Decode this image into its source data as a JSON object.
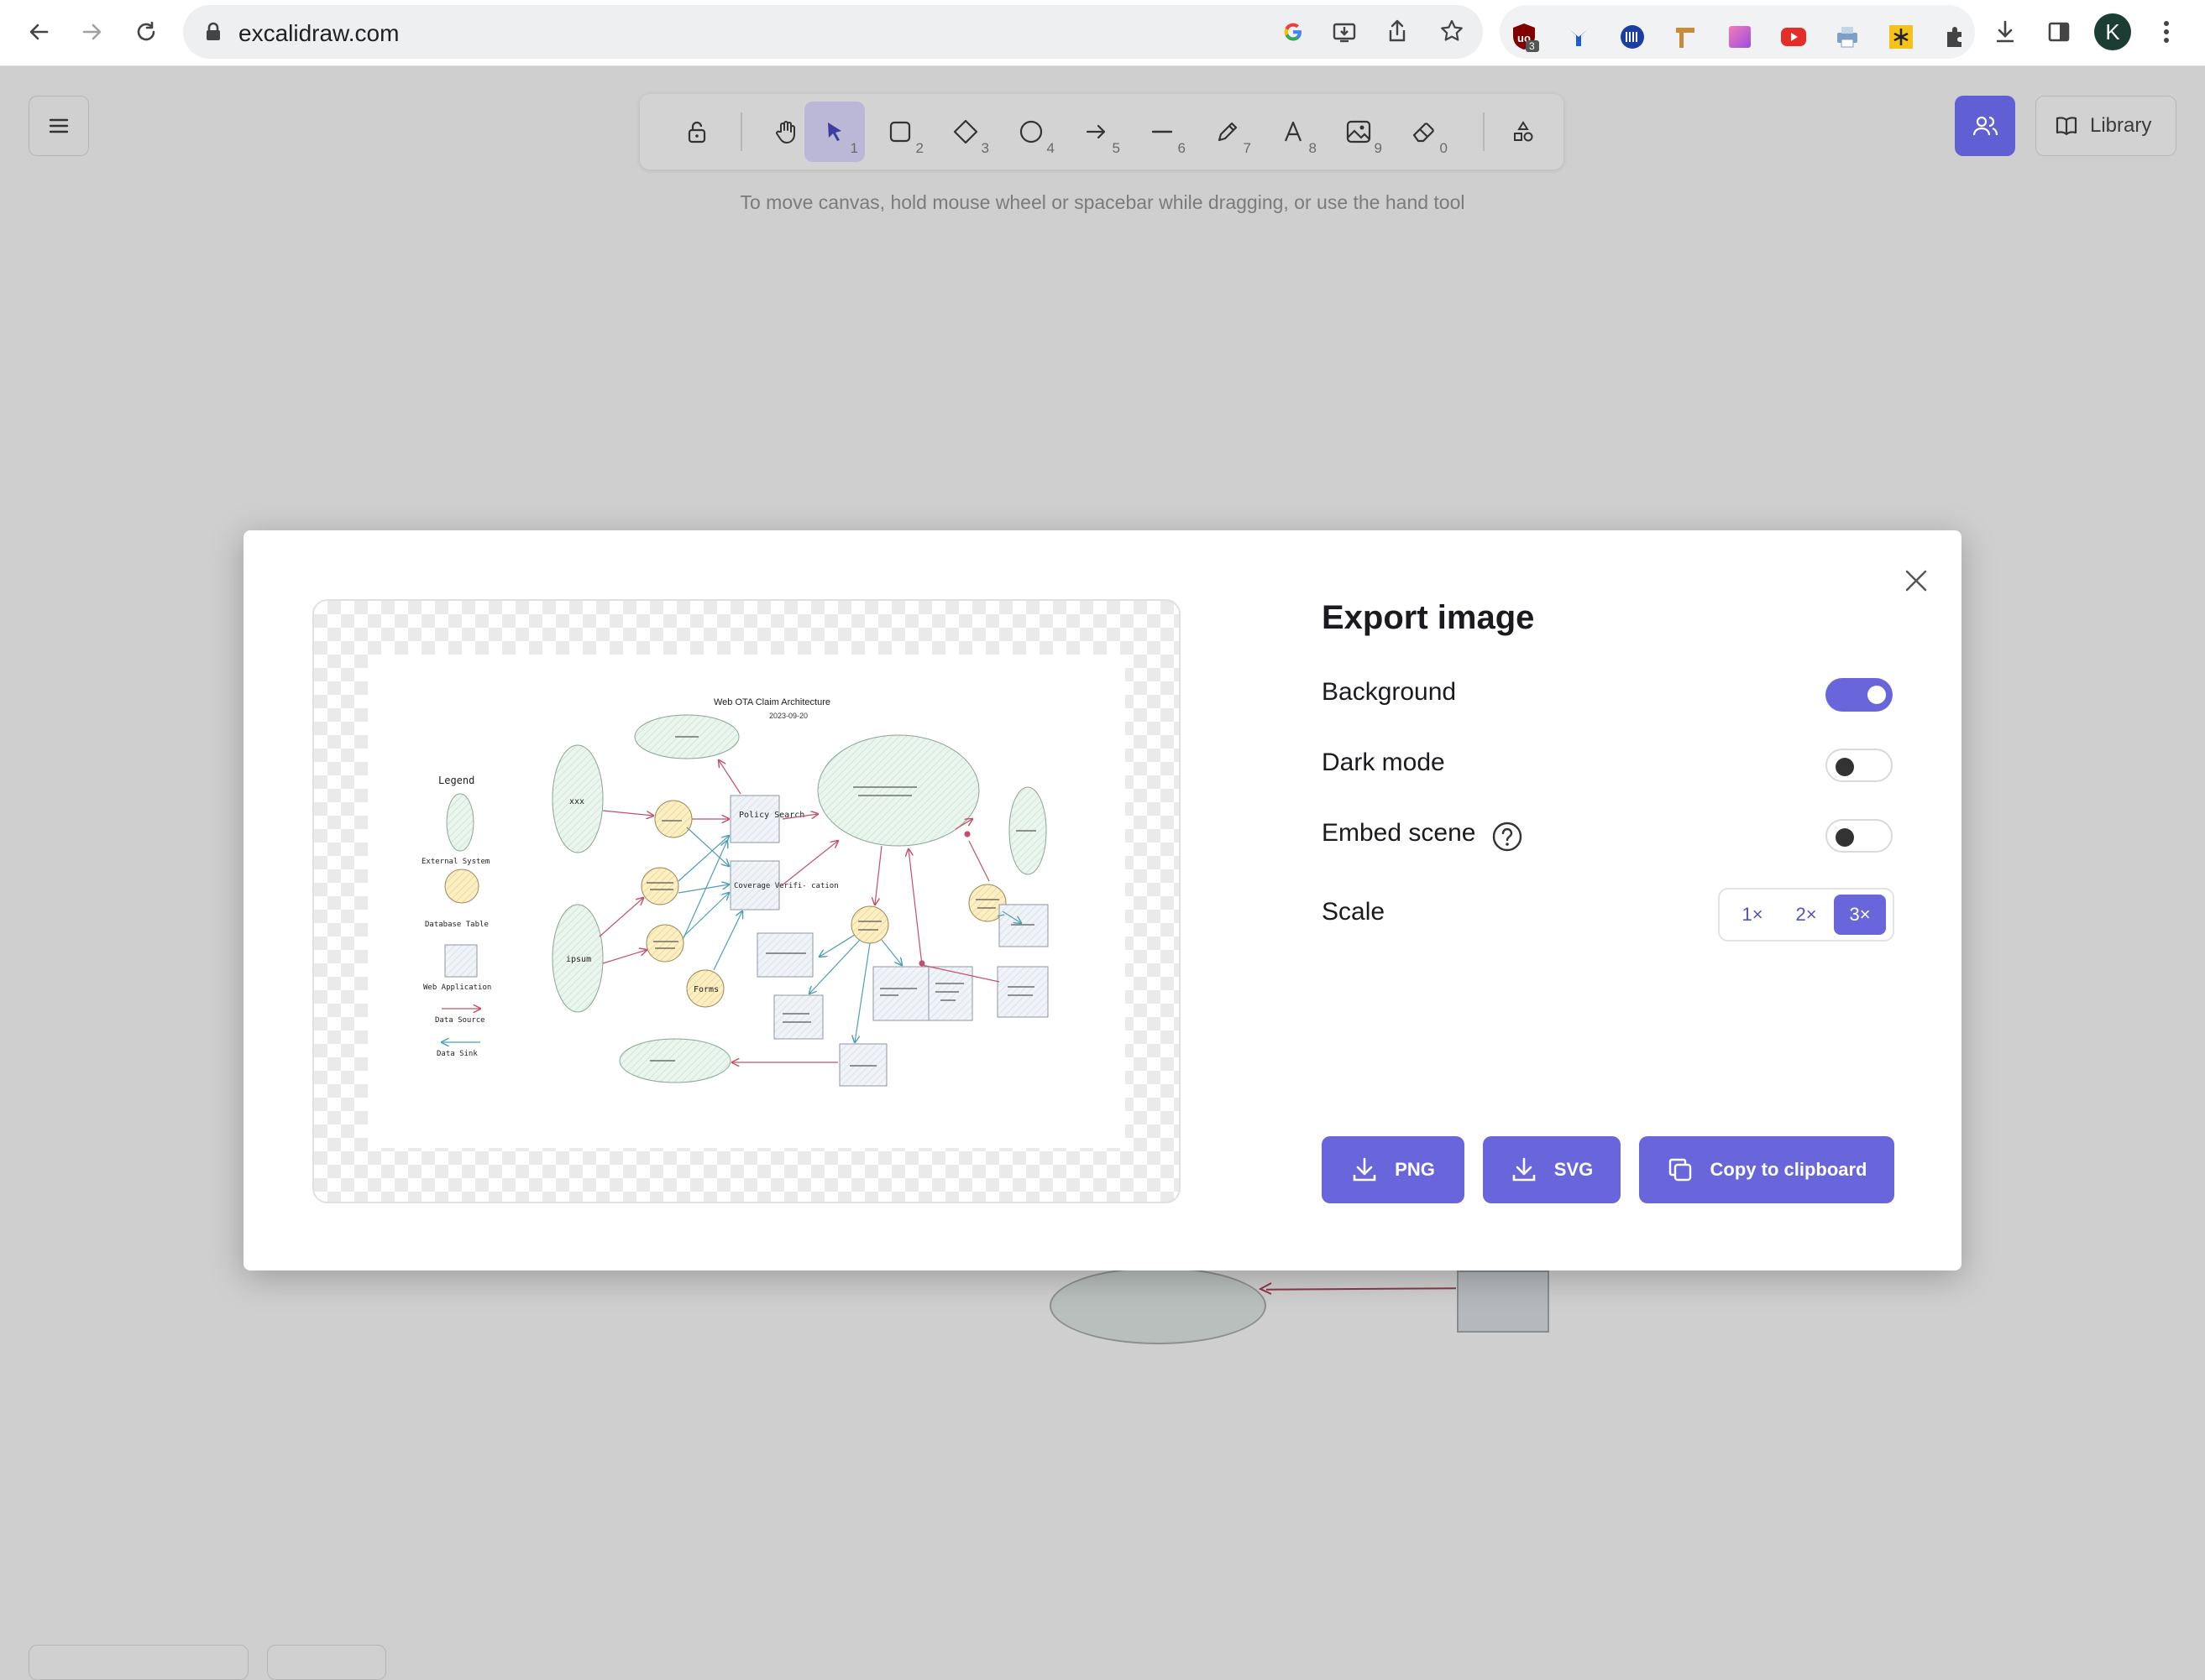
{
  "browser": {
    "url": "excalidraw.com",
    "extension_badge": "3",
    "profile_initial": "K"
  },
  "app": {
    "hint": "To move canvas, hold mouse wheel or spacebar while dragging, or use the hand tool",
    "library_label": "Library",
    "toolbar": {
      "tools": [
        {
          "name": "lock",
          "num": ""
        },
        {
          "name": "hand",
          "num": ""
        },
        {
          "name": "selection",
          "num": "1"
        },
        {
          "name": "rectangle",
          "num": "2"
        },
        {
          "name": "diamond",
          "num": "3"
        },
        {
          "name": "ellipse",
          "num": "4"
        },
        {
          "name": "arrow",
          "num": "5"
        },
        {
          "name": "line",
          "num": "6"
        },
        {
          "name": "draw",
          "num": "7"
        },
        {
          "name": "text",
          "num": "8"
        },
        {
          "name": "image",
          "num": "9"
        },
        {
          "name": "eraser",
          "num": "0"
        },
        {
          "name": "more-shapes",
          "num": ""
        }
      ]
    }
  },
  "dialog": {
    "title": "Export image",
    "options": {
      "background": {
        "label": "Background",
        "on": true
      },
      "dark_mode": {
        "label": "Dark mode",
        "on": false
      },
      "embed_scene": {
        "label": "Embed scene",
        "on": false
      }
    },
    "scale": {
      "label": "Scale",
      "options": [
        "1×",
        "2×",
        "3×"
      ],
      "selected": "3×"
    },
    "buttons": {
      "png": "PNG",
      "svg": "SVG",
      "clipboard": "Copy to clipboard"
    },
    "preview": {
      "title": "Web OTA Claim Architecture",
      "date": "2023-09-20",
      "legend": {
        "heading": "Legend",
        "external_system": "External System",
        "database_table": "Database Table",
        "web_application": "Web Application",
        "data_source": "Data Source",
        "data_sink": "Data Sink"
      },
      "labels": {
        "xxx": "xxx",
        "ipsum": "ipsum",
        "policy_search": "Policy Search",
        "coverage_verification": "Coverage Verifi- cation",
        "forms": "Forms"
      }
    }
  },
  "colors": {
    "accent": "#6965db",
    "accent_light": "#bab7d7",
    "external_fill": "#e6f3ec",
    "db_fill": "#fbeec2",
    "webapp_fill": "#eef1f5",
    "source_arrow": "#c3506a",
    "sink_arrow": "#4d9fb4"
  }
}
